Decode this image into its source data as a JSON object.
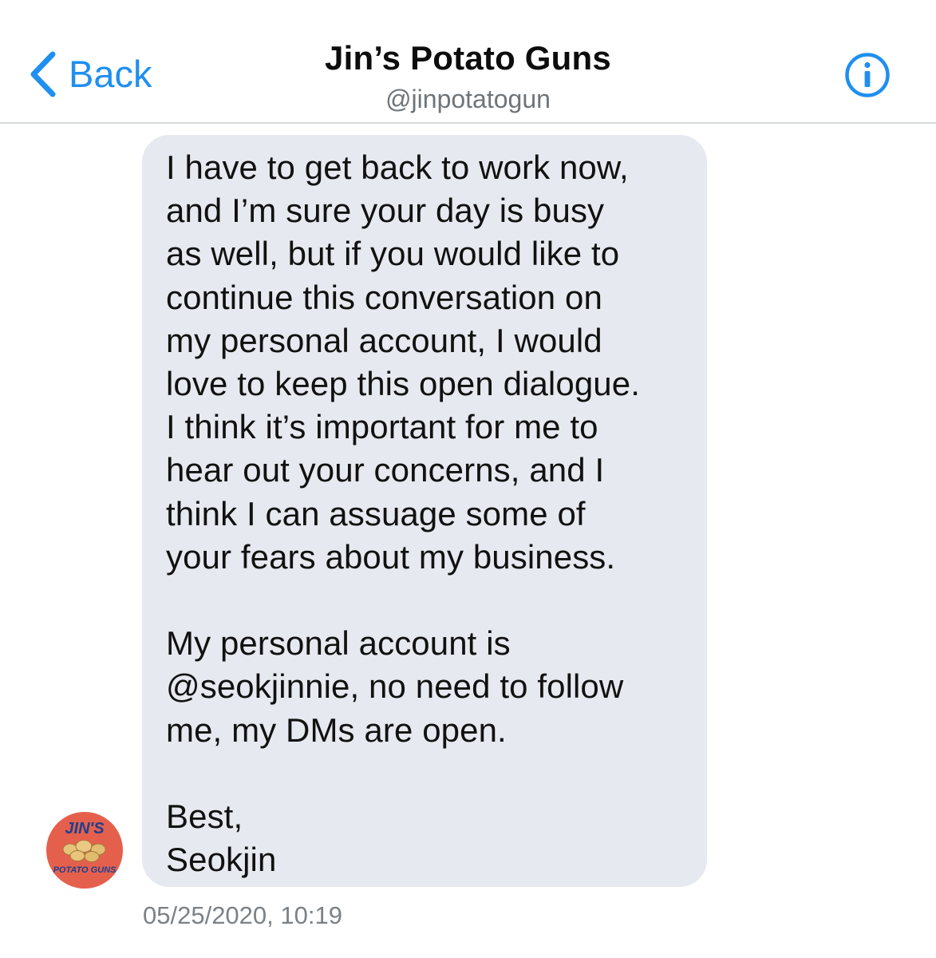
{
  "header": {
    "back_label": "Back",
    "title": "Jin’s Potato Guns",
    "handle": "@jinpotatogun",
    "info_icon": "info-circle-icon",
    "back_icon": "chevron-left-icon",
    "accent_color": "#1f8ff0"
  },
  "message": {
    "text": "I have to get back to work now,\nand I’m sure your day is busy\nas well, but if you would like to\ncontinue this conversation on\nmy personal account, I would\nlove to keep this open dialogue.\nI think it’s important for me to\nhear out your concerns, and I\nthink I can assuage some of\nyour fears about my business.\n\nMy personal account is\n@seokjinnie, no need to follow\nme, my DMs are open.\n\nBest,\nSeokjin",
    "timestamp": "05/25/2020, 10:19",
    "bubble_color": "#e6e9ef"
  },
  "avatar": {
    "line1": "JIN'S",
    "line2": "POTATO GUNS",
    "background_color": "#e5604c"
  }
}
